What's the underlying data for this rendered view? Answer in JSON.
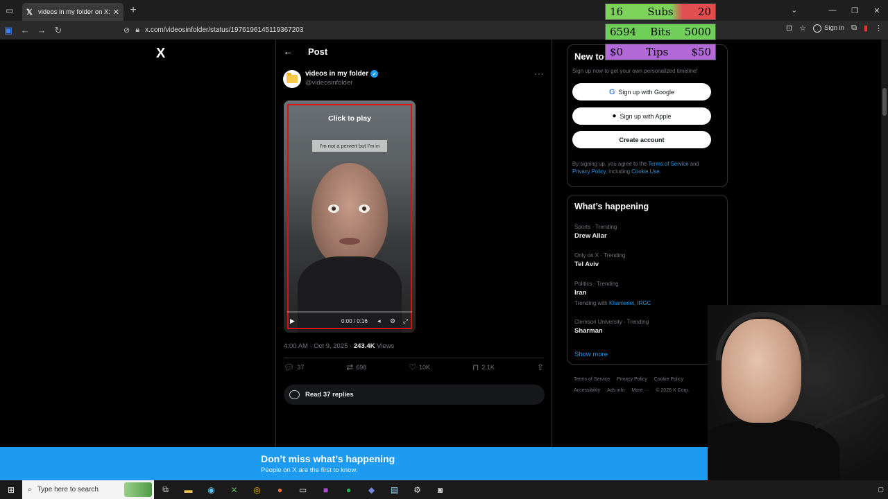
{
  "browser": {
    "tab_title": "videos in my folder on X: \"https:",
    "url": "x.com/videosinfolder/status/1976196145119367203",
    "signin_label": "Sign in",
    "icons": [
      "tab-list-icon",
      "x-favicon",
      "close-icon",
      "plus-icon",
      "chevron-down-icon",
      "minimize-icon",
      "maximize-icon",
      "window-close-icon",
      "sidebar-icon",
      "back-icon",
      "forward-icon",
      "reload-icon",
      "site-info-icon",
      "lock-icon",
      "save-icon",
      "star-icon",
      "person-icon",
      "extensions-icon",
      "more-icon"
    ]
  },
  "nav": {
    "logo": "X"
  },
  "post": {
    "header_title": "Post",
    "author_name": "videos in my folder",
    "author_handle": "@videosinfolder",
    "video": {
      "click_to_play": "Click to play",
      "caption": "I'm not a pervert but I'm in",
      "time": "0:00 / 0:16"
    },
    "time": "4:00 AM · Oct 9, 2025 · ",
    "views_count": "243.4K",
    "views_label": " Views",
    "actions": {
      "replies": "37",
      "reposts": "698",
      "likes": "10K",
      "bookmarks": "2.1K"
    },
    "read_replies": "Read 37 replies"
  },
  "signup": {
    "title": "New to",
    "subtitle": "Sign up now to get your own personalized timeline!",
    "google": "Sign up with Google",
    "apple": "Sign up with Apple",
    "create": "Create account",
    "terms_prefix": "By signing up, you agree to the ",
    "terms_link": "Terms of Service",
    "terms_and": " and ",
    "privacy_link": "Privacy Policy",
    "terms_including": ", including ",
    "cookie_link": "Cookie Use",
    "terms_end": "."
  },
  "trends": {
    "title": "What’s happening",
    "items": [
      {
        "meta": "Sports · Trending",
        "name": "Drew Allar"
      },
      {
        "meta": "Only on X · Trending",
        "name": "Tel Aviv"
      },
      {
        "meta": "Politics · Trending",
        "name": "Iran",
        "with_label": "Trending with ",
        "with_links": "Khamenei, IRGC"
      },
      {
        "meta": "Clemson University · Trending",
        "name": "Sharman"
      }
    ],
    "show_more": "Show more"
  },
  "footer": {
    "links": [
      "Terms of Service",
      "Privacy Policy",
      "Cookie Policy",
      "Accessibility",
      "Ads info",
      "More ···",
      "© 2026 X Corp."
    ]
  },
  "overlay": {
    "subs": {
      "current": "16",
      "label": "Subs",
      "goal": "20"
    },
    "bits": {
      "current": "6594",
      "label": "Bits",
      "goal": "5000"
    },
    "tips": {
      "current": "$0",
      "label": "Tips",
      "goal": "$50"
    }
  },
  "banner": {
    "title": "Don’t miss what’s happening",
    "subtitle": "People on X are the first to know."
  },
  "taskbar": {
    "search_placeholder": "Type here to search"
  },
  "colors": {
    "accent": "#1d9bf0",
    "background": "#000000",
    "border": "#2f3336"
  }
}
